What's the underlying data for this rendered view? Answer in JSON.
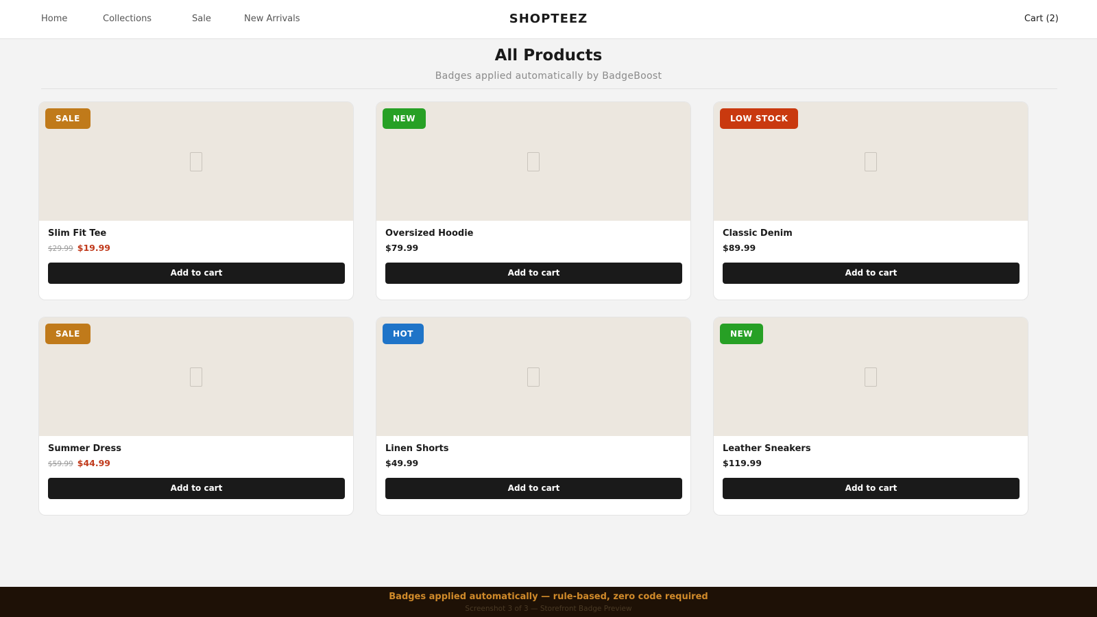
{
  "nav": {
    "links": [
      "Home",
      "Collections",
      "Sale",
      "New Arrivals"
    ],
    "brand": "SHOPTEEZ",
    "cart_label": "Cart (2)"
  },
  "heading": {
    "title": "All Products",
    "subtitle": "Badges applied automatically by BadgeBoost"
  },
  "badge_colors": {
    "SALE": "#c07a1a",
    "NEW": "#27a025",
    "LOW STOCK": "#c9390f",
    "HOT": "#1f74c8"
  },
  "products": [
    {
      "badge": "SALE",
      "name": "Slim Fit Tee",
      "original_price": "$29.99",
      "price": "$19.99",
      "on_sale": true,
      "button_label": "Add to cart",
      "image_icon": "image-placeholder-icon"
    },
    {
      "badge": "NEW",
      "name": "Oversized Hoodie",
      "original_price": "",
      "price": "$79.99",
      "on_sale": false,
      "button_label": "Add to cart",
      "image_icon": "image-placeholder-icon"
    },
    {
      "badge": "LOW STOCK",
      "name": "Classic Denim",
      "original_price": "",
      "price": "$89.99",
      "on_sale": false,
      "button_label": "Add to cart",
      "image_icon": "image-placeholder-icon"
    },
    {
      "badge": "SALE",
      "name": "Summer Dress",
      "original_price": "$59.99",
      "price": "$44.99",
      "on_sale": true,
      "button_label": "Add to cart",
      "image_icon": "image-placeholder-icon"
    },
    {
      "badge": "HOT",
      "name": "Linen Shorts",
      "original_price": "",
      "price": "$49.99",
      "on_sale": false,
      "button_label": "Add to cart",
      "image_icon": "image-placeholder-icon"
    },
    {
      "badge": "NEW",
      "name": "Leather Sneakers",
      "original_price": "",
      "price": "$119.99",
      "on_sale": false,
      "button_label": "Add to cart",
      "image_icon": "image-placeholder-icon"
    }
  ],
  "footer": {
    "tagline": "Badges applied automatically — rule-based, zero code required",
    "caption": "Screenshot 3 of 3  —  Storefront Badge Preview"
  }
}
